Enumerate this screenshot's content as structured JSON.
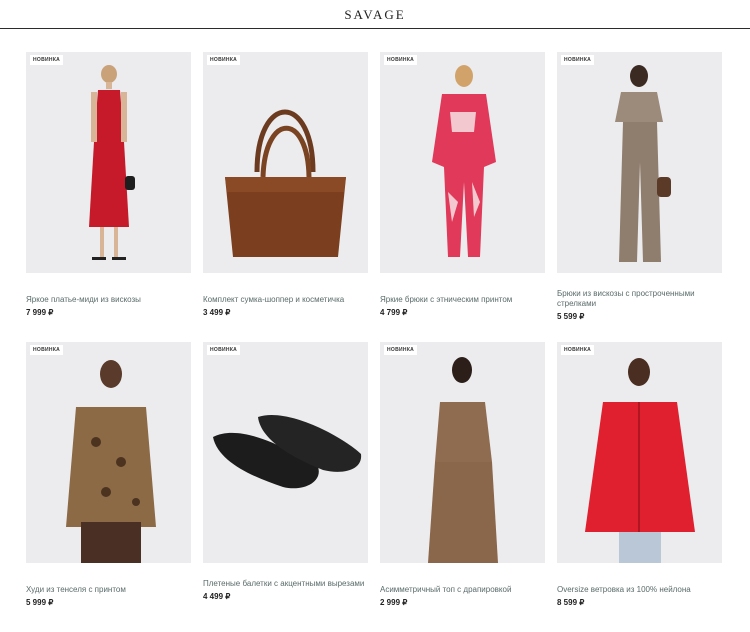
{
  "header": {
    "logo": "SAVAGE"
  },
  "products": [
    {
      "badge": "НОВИНКА",
      "name": "Яркое платье-миди из вискозы",
      "price": "7 999 ₽"
    },
    {
      "badge": "НОВИНКА",
      "name": "Комплект сумка-шоппер и косметичка",
      "price": "3 499 ₽"
    },
    {
      "badge": "НОВИНКА",
      "name": "Яркие брюки с этническим принтом",
      "price": "4 799 ₽"
    },
    {
      "badge": "НОВИНКА",
      "name": "Брюки из вискозы с простроченными стрелками",
      "price": "5 599 ₽"
    },
    {
      "badge": "НОВИНКА",
      "name": "Худи из тенселя с принтом",
      "price": "5 999 ₽"
    },
    {
      "badge": "НОВИНКА",
      "name": "Плетеные балетки с акцентными вырезами",
      "price": "4 499 ₽"
    },
    {
      "badge": "НОВИНКА",
      "name": "Асимметричный топ с драпировкой",
      "price": "2 999 ₽"
    },
    {
      "badge": "НОВИНКА",
      "name": "Oversize ветровка из 100% нейлона",
      "price": "8 599 ₽"
    }
  ]
}
